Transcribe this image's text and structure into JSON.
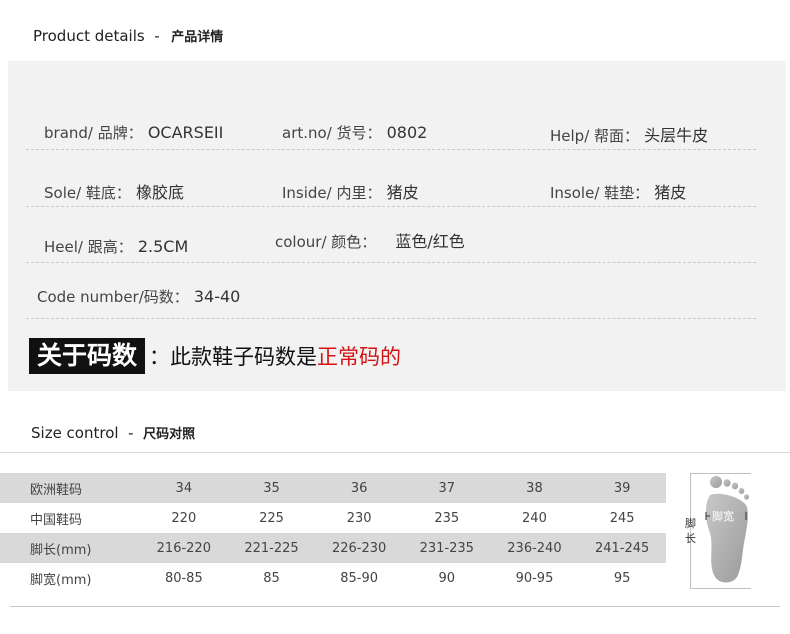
{
  "product_details": {
    "title_en": "Product details",
    "title_sep": "-",
    "title_zh": "产品详情",
    "fields": [
      {
        "label": "brand/ 品牌：",
        "value": "OCARSEII"
      },
      {
        "label": "art.no/ 货号：",
        "value": "0802"
      },
      {
        "label": "Help/ 帮面：",
        "value": "头层牛皮"
      },
      {
        "label": "Sole/ 鞋底：",
        "value": "橡胶底"
      },
      {
        "label": "Inside/ 内里：",
        "value": "猪皮"
      },
      {
        "label": "Insole/ 鞋垫：",
        "value": "猪皮"
      },
      {
        "label": "Heel/ 跟高：",
        "value": "2.5CM"
      },
      {
        "label": "colour/ 颜色：",
        "value": "蓝色/红色"
      },
      {
        "label": "Code number/码数：",
        "value": "34-40"
      }
    ],
    "about_size": {
      "label": "关于码数",
      "colon": "：",
      "text_black": "此款鞋子码数是",
      "text_red": "正常码的"
    }
  },
  "size_control": {
    "title_en": "Size control",
    "title_sep": "-",
    "title_zh": "尺码对照",
    "rows": [
      {
        "header": "欧洲鞋码",
        "cells": [
          "34",
          "35",
          "36",
          "37",
          "38",
          "39"
        ]
      },
      {
        "header": "中国鞋码",
        "cells": [
          "220",
          "225",
          "230",
          "235",
          "240",
          "245"
        ]
      },
      {
        "header": "脚长(mm)",
        "cells": [
          "216-220",
          "221-225",
          "226-230",
          "231-235",
          "236-240",
          "241-245"
        ]
      },
      {
        "header": "脚宽(mm)",
        "cells": [
          "80-85",
          "85",
          "85-90",
          "90",
          "90-95",
          "95"
        ]
      }
    ],
    "foot_length_label": "脚长",
    "foot_width_label": "脚宽"
  },
  "colors": {
    "about_red": "#d41414",
    "panel_gray": "#f2f2f2",
    "row_gray": "#d9d9d9"
  }
}
